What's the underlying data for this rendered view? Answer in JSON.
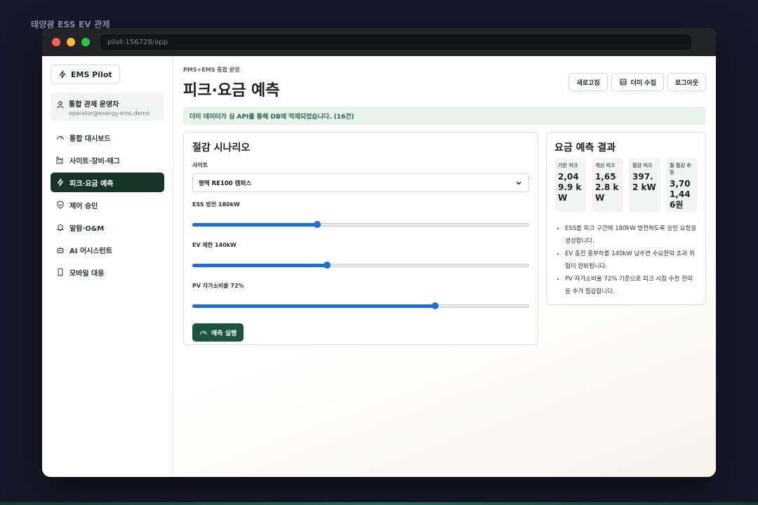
{
  "outer_title": "태양광 ESS EV 관제",
  "browser": {
    "url": "pilot-156728/app"
  },
  "sidebar": {
    "brand": "EMS Pilot",
    "user": {
      "name": "통합 관제 운영자",
      "email": "operator@energy-ems.demo"
    },
    "items": [
      {
        "label": "통합 대시보드",
        "icon": "gauge-icon"
      },
      {
        "label": "사이트·장비·태그",
        "icon": "factory-icon"
      },
      {
        "label": "피크·요금 예측",
        "icon": "bolt-icon",
        "active": true
      },
      {
        "label": "제어 승인",
        "icon": "shield-check-icon"
      },
      {
        "label": "알람·O&M",
        "icon": "bell-icon"
      },
      {
        "label": "AI 어시스턴트",
        "icon": "bot-icon"
      },
      {
        "label": "모바일 대응",
        "icon": "phone-icon"
      }
    ]
  },
  "header": {
    "eyebrow": "PMS+EMS 통합 운영",
    "title": "피크·요금 예측",
    "actions": {
      "refresh": "새로고침",
      "collect": "더미 수집",
      "logout": "로그아웃"
    }
  },
  "banner": "더미 데이터가 실 API를 통해 DB에 적재되었습니다. (16건)",
  "scenario": {
    "title": "절감 시나리오",
    "site_label": "사이트",
    "site_value": "평택 RE100 캠퍼스",
    "sliders": [
      {
        "label": "ESS 방전 180kW",
        "fraction": 0.37
      },
      {
        "label": "EV 제한 140kW",
        "fraction": 0.4
      },
      {
        "label": "PV 자가소비율 72%",
        "fraction": 0.72
      }
    ],
    "run_label": "예측 실행"
  },
  "result": {
    "title": "요금 예측 결과",
    "metrics": [
      {
        "label": "기준 피크",
        "value": "2,049.9 kW"
      },
      {
        "label": "개선 피크",
        "value": "1,652.8 kW"
      },
      {
        "label": "절감 피크",
        "value": "397.2 kW"
      },
      {
        "label": "월 절감 추정",
        "value": "3,701,446원"
      }
    ],
    "notes": [
      "ESS를 피크 구간에 180kW 방전하도록 승인 요청을 생성합니다.",
      "EV 충전 총부하를 140kW 낮추면 수요전력 초과 위험이 완화됩니다.",
      "PV 자가소비율 72% 기준으로 피크 시점 수전 전력을 추가 절감합니다."
    ]
  },
  "colors": {
    "accent": "#173528",
    "primary_button": "#19563d",
    "slider": "#1b6fd6",
    "banner_bg": "#e8f3ec"
  }
}
